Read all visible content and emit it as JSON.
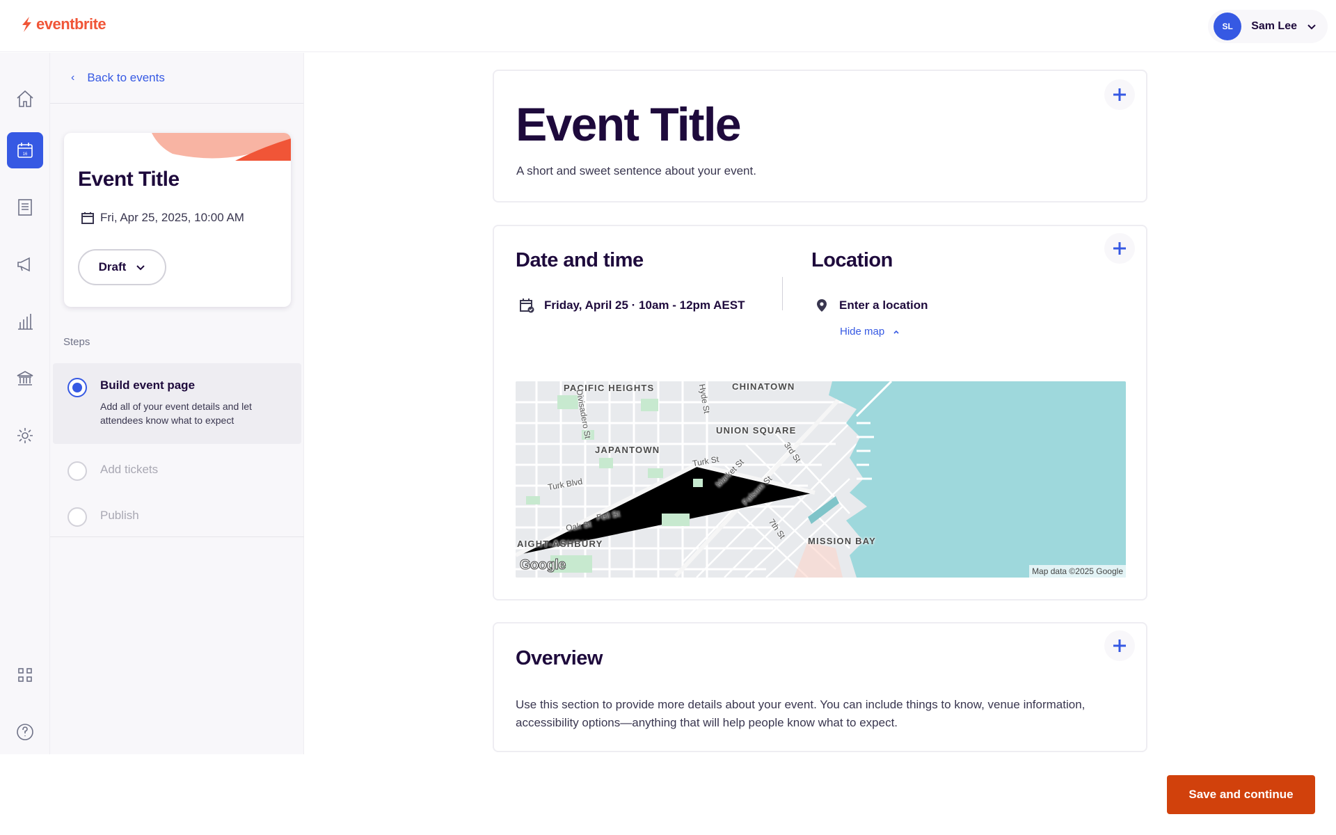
{
  "brand": {
    "name": "eventbrite",
    "color": "#f05537",
    "accent": "#3659e3",
    "cta": "#d1410c"
  },
  "user": {
    "initials": "SL",
    "name": "Sam Lee"
  },
  "rail": {
    "icons": [
      "home-icon",
      "calendar-icon",
      "orders-icon",
      "megaphone-icon",
      "bar-chart-icon",
      "bank-icon",
      "gear-icon",
      "grid-apps-icon",
      "help-icon"
    ],
    "active": "calendar-icon"
  },
  "sidepanel": {
    "back_label": "Back to events",
    "event_card": {
      "title": "Event Title",
      "date": "Fri, Apr 25, 2025, 10:00 AM",
      "status": "Draft"
    },
    "steps_label": "Steps",
    "steps": [
      {
        "title": "Build event page",
        "description": "Add all of your event details and let attendees know what to expect",
        "state": "active"
      },
      {
        "title": "Add tickets",
        "state": "disabled"
      },
      {
        "title": "Publish",
        "state": "disabled"
      }
    ]
  },
  "main": {
    "title_card": {
      "title": "Event Title",
      "summary": "A short and sweet sentence about your event."
    },
    "datetime": {
      "heading": "Date and time",
      "value": "Friday, April 25 · 10am - 12pm AEST"
    },
    "location": {
      "heading": "Location",
      "value": "Enter a location",
      "toggle": "Hide map"
    },
    "map": {
      "neighborhoods": [
        "PACIFIC HEIGHTS",
        "CHINATOWN",
        "UNION SQUARE",
        "JAPANTOWN",
        "AIGHT-ASHBURY",
        "MISSION BAY"
      ],
      "streets": [
        "Hyde St",
        "Divisadero St",
        "3rd St",
        "Turk St",
        "Market St",
        "Turk Blvd",
        "Folsom St",
        "Fell St",
        "Oak St",
        "7th St"
      ],
      "logo": "Google",
      "credit": "Map data ©2025 Google"
    },
    "overview": {
      "heading": "Overview",
      "body": "Use this section to provide more details about your event. You can include things to know, venue information, accessibility options—anything that will help people know what to expect."
    }
  },
  "footer": {
    "save_label": "Save and continue"
  }
}
